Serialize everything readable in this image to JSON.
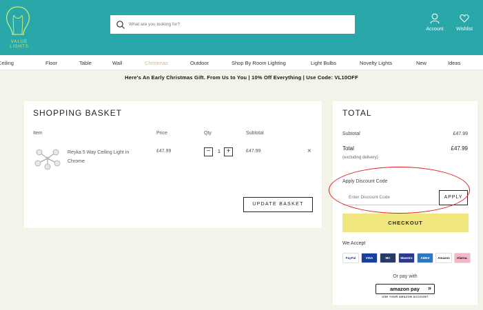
{
  "brand": {
    "logo_text": "VALUE LIGHTS"
  },
  "search": {
    "placeholder": "What are you looking for?"
  },
  "header": {
    "account_label": "Account",
    "wishlist_label": "Wishlist"
  },
  "nav": {
    "items": [
      "Ceiling",
      "Floor",
      "Table",
      "Wall",
      "Christmas",
      "Outdoor",
      "Shop By Room Lighting",
      "Light Bulbs",
      "Novelty Lights",
      "New",
      "Ideas"
    ]
  },
  "promo": {
    "text": "Here's An Early Christmas Gift. From Us to You | 10% Off Everything | Use Code: VL10OFF"
  },
  "basket": {
    "title": "SHOPPING BASKET",
    "columns": {
      "item": "Item",
      "price": "Price",
      "qty": "Qty",
      "subtotal": "Subtotal"
    },
    "item": {
      "name": "Reyka 5 Way Ceiling Light in Chrome",
      "price": "£47.99",
      "quantity": "1",
      "subtotal": "£47.99",
      "remove": "×"
    },
    "update_label": "UPDATE BASKET",
    "qty_minus": "−",
    "qty_plus": "+"
  },
  "total": {
    "title": "TOTAL",
    "subtotal_label": "Subtotal",
    "subtotal_value": "£47.99",
    "total_label": "Total",
    "total_value": "£47.99",
    "total_note": "(excluding delivery)",
    "discount_label": "Apply Discount Code",
    "discount_placeholder": "Enter Discount Code",
    "apply_label": "APPLY",
    "checkout_label": "CHECKOUT",
    "accept_label": "We Accept",
    "cards": [
      {
        "name": "PayPal",
        "bg": "#ffffff",
        "fg": "#1f3f8f"
      },
      {
        "name": "VISA",
        "bg": "#1a3f9a",
        "fg": "#ffffff"
      },
      {
        "name": "MC",
        "bg": "#2a3866",
        "fg": "#ffffff"
      },
      {
        "name": "Maestro",
        "bg": "#2d3a8c",
        "fg": "#ffffff"
      },
      {
        "name": "AMEX",
        "bg": "#2e77bc",
        "fg": "#ffffff"
      },
      {
        "name": "Amazon",
        "bg": "#ffffff",
        "fg": "#222222"
      },
      {
        "name": "Klarna.",
        "bg": "#f5b6c7",
        "fg": "#111111"
      }
    ],
    "or_pay_label": "Or pay with",
    "amazon_label": "amazon pay",
    "amazon_sub": "USE YOUR AMAZON ACCOUNT"
  },
  "colors": {
    "header": "#29a7a9",
    "checkout": "#efe67d",
    "highlight": "#e0191f"
  }
}
